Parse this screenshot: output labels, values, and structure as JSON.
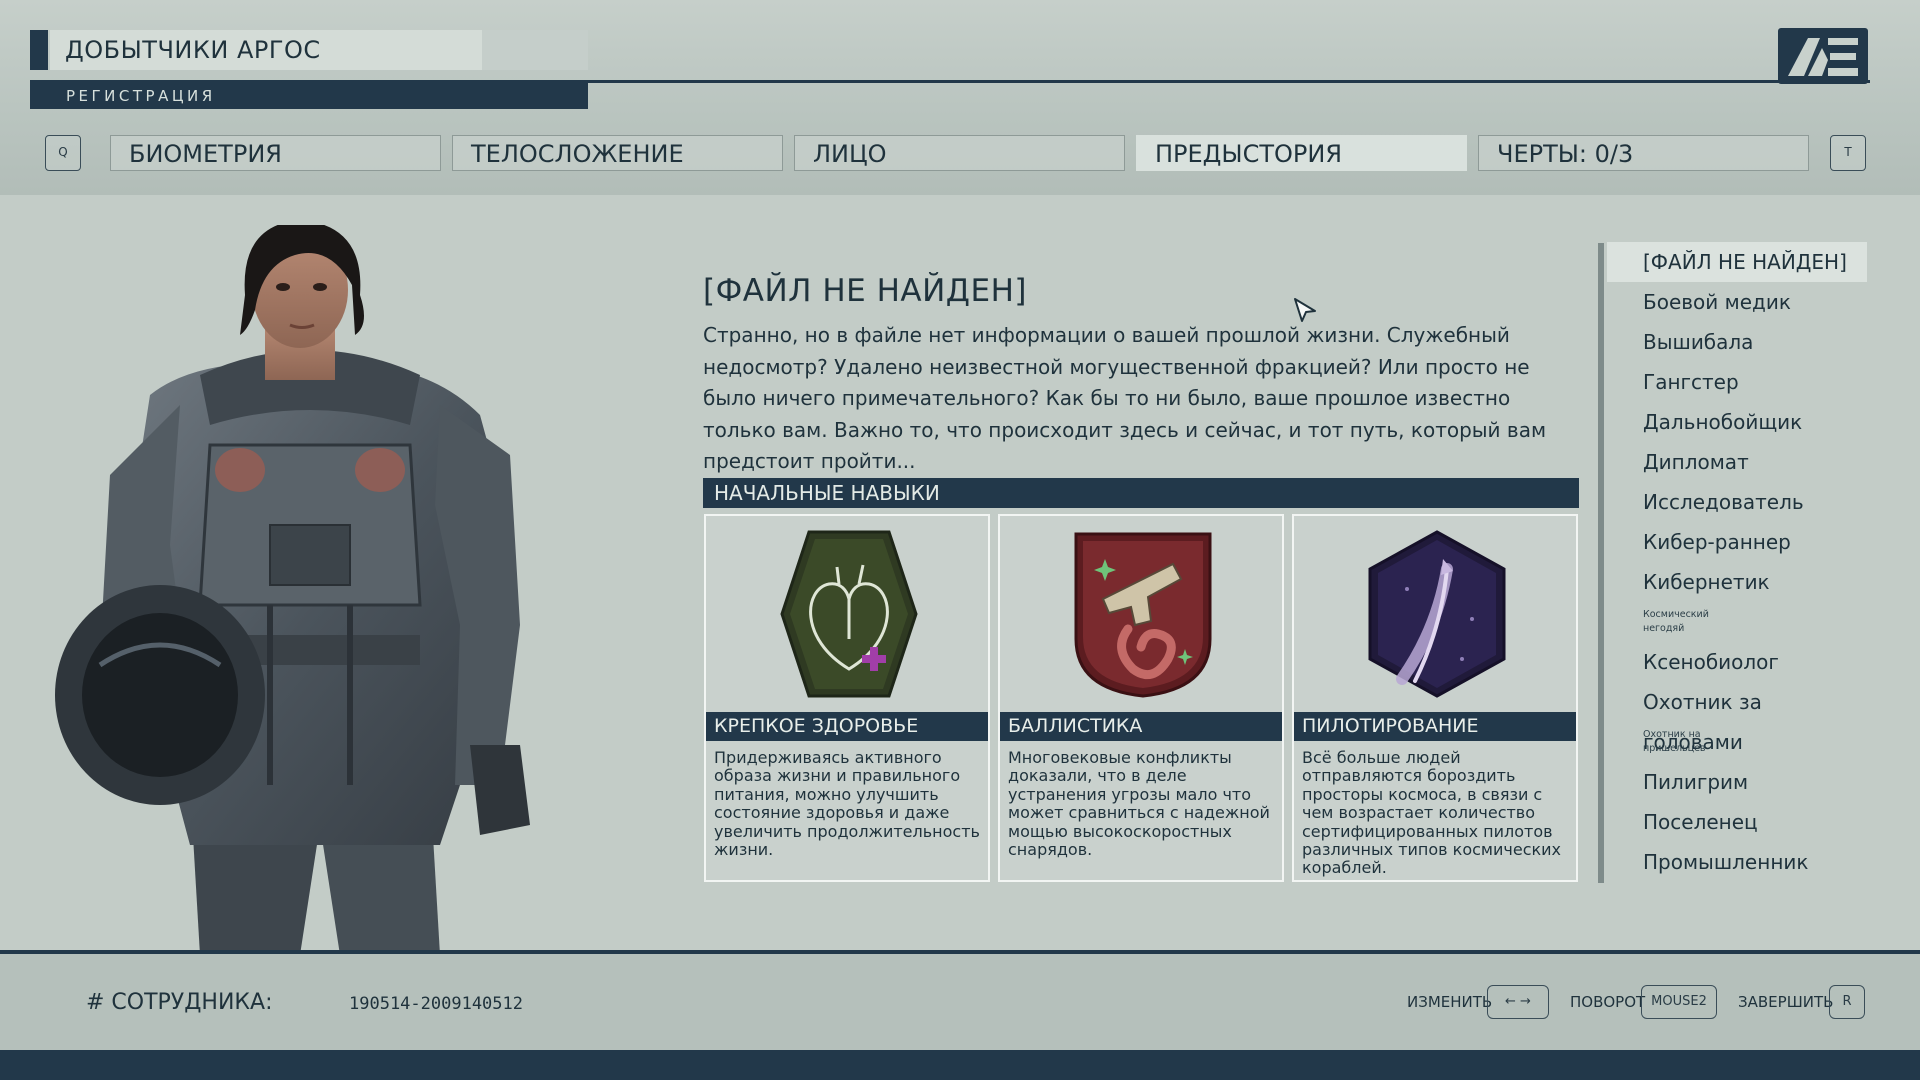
{
  "header": {
    "company": "ДОБЫТЧИКИ АРГОС",
    "subtitle": "РЕГИСТРАЦИЯ",
    "logo_icon": "constellation-logo-icon",
    "accent_color": "#22384a"
  },
  "nav": {
    "prev_key": "Q",
    "next_key": "T",
    "tabs": [
      {
        "label": "БИОМЕТРИЯ"
      },
      {
        "label": "ТЕЛОСЛОЖЕНИЕ"
      },
      {
        "label": "ЛИЦО"
      },
      {
        "label": "ПРЕДЫСТОРИЯ"
      },
      {
        "label": "ЧЕРТЫ: 0/3"
      }
    ],
    "active_tab": "ПРЕДЫСТОРИЯ"
  },
  "background": {
    "title": "[ФАЙЛ НЕ НАЙДЕН]",
    "description": "Странно, но в файле нет информации о вашей прошлой жизни. Служебный недосмотр? Удалено неизвестной могущественной фракцией? Или просто не было ничего примечательного? Как бы то ни было, ваше прошлое известно только вам. Важно то, что происходит здесь и сейчас, и тот путь, который вам предстоит пройти...",
    "skills_header": "НАЧАЛЬНЫЕ НАВЫКИ",
    "skills": [
      {
        "name": "КРЕПКОЕ ЗДОРОВЬЕ",
        "icon": "heart-badge-icon",
        "description": "Придерживаясь активного образа жизни и правильного питания, можно улучшить состояние здоровья и даже увеличить продолжительность жизни."
      },
      {
        "name": "БАЛЛИСТИКА",
        "icon": "pistol-badge-icon",
        "description": "Многовековые конфликты доказали, что в деле устранения угрозы мало что может сравниться с надежной мощью высокоскоростных снарядов."
      },
      {
        "name": "ПИЛОТИРОВАНИЕ",
        "icon": "rocket-trail-badge-icon",
        "description": "Всё больше людей отправляются бороздить просторы космоса, в связи с чем возрастает количество сертифицированных пилотов различных типов космических кораблей."
      }
    ]
  },
  "background_list": [
    {
      "label": "[ФАЙЛ НЕ НАЙДЕН]",
      "selected": true
    },
    {
      "label": "Боевой медик"
    },
    {
      "label": "Вышибала"
    },
    {
      "label": "Гангстер"
    },
    {
      "label": "Дальнобойщик"
    },
    {
      "label": "Дипломат"
    },
    {
      "label": "Исследователь"
    },
    {
      "label": "Кибер-раннер"
    },
    {
      "label": "Кибернетик"
    },
    {
      "label": "Космический негодяй",
      "small": true
    },
    {
      "label": "Ксенобиолог"
    },
    {
      "label": "Охотник за головами"
    },
    {
      "label": "Охотник на пришельцев",
      "small": true
    },
    {
      "label": "Пилигрим"
    },
    {
      "label": "Поселенец"
    },
    {
      "label": "Промышленник"
    }
  ],
  "footer": {
    "employee_label": "# СОТРУДНИКА:",
    "employee_id": "190514-2009140512",
    "hints": [
      {
        "label": "ИЗМЕНИТЬ",
        "key": "← →"
      },
      {
        "label": "ПОВОРОТ",
        "key": "MOUSE2"
      },
      {
        "label": "ЗАВЕРШИТЬ",
        "key": "R"
      }
    ]
  }
}
